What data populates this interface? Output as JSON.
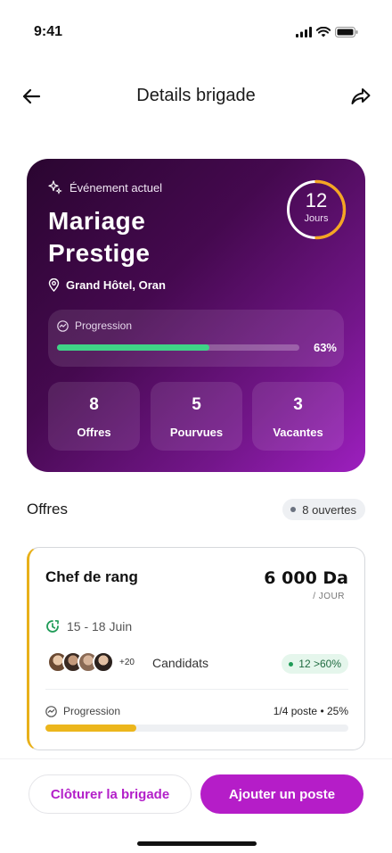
{
  "status_bar": {
    "time": "9:41"
  },
  "nav": {
    "title": "Details brigade"
  },
  "hero": {
    "tag": "Événement actuel",
    "title_line1": "Mariage",
    "title_line2": "Prestige",
    "location": "Grand Hôtel, Oran",
    "countdown": {
      "value": "12",
      "unit": "Jours"
    },
    "progress": {
      "label": "Progression",
      "percent_label": "63%",
      "value": 0.63
    },
    "stats": [
      {
        "value": "8",
        "label": "Offres"
      },
      {
        "value": "5",
        "label": "Pourvues"
      },
      {
        "value": "3",
        "label": "Vacantes"
      }
    ]
  },
  "offers_section": {
    "title": "Offres",
    "badge": "8 ouvertes"
  },
  "offer_card": {
    "title": "Chef de rang",
    "price": "6 000 Da",
    "unit": "/ JOUR",
    "dates": "15 - 18 Juin",
    "candidates_more": "+20",
    "candidates_label": "Candidats",
    "match_badge": "12 >60%",
    "progress_label": "Progression",
    "progress_stat": "1/4 poste • 25%",
    "progress_value": 0.3
  },
  "actions": {
    "close_label": "Clôturer la brigade",
    "add_label": "Ajouter un poste"
  },
  "colors": {
    "accent": "#b51dc8",
    "progress_green": "#3fd487",
    "progress_yellow": "#ecb61c",
    "ring": "#f5a623"
  }
}
